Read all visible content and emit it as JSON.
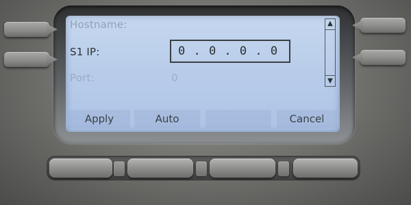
{
  "fields": {
    "hostname": {
      "label": "Hostname:"
    },
    "s1_ip": {
      "label": "S1 IP:",
      "value": "0 . 0 . 0 . 0"
    },
    "port": {
      "label": "Port:",
      "value": "0"
    }
  },
  "scroll": {
    "up_icon": "▲",
    "down_icon": "▼"
  },
  "softkeys": [
    {
      "label": "Apply"
    },
    {
      "label": "Auto"
    },
    {
      "label": ""
    },
    {
      "label": "Cancel"
    }
  ],
  "colors": {
    "screen_background": "#bcd0ec",
    "housing": "#7a7a77"
  }
}
